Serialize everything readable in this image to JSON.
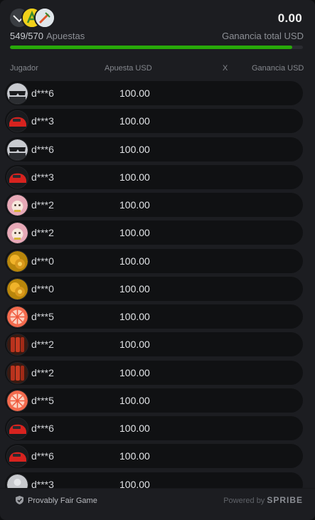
{
  "summary": {
    "total_win": "0.00",
    "bets_count": "549/570",
    "bets_label": "Apuestas",
    "total_win_label": "Ganancia total USD",
    "progress": 0.963
  },
  "columns": {
    "player": "Jugador",
    "bet": "Apuesta USD",
    "multiplier": "X",
    "win": "Ganancia USD"
  },
  "rows": [
    {
      "player": "d***6",
      "bet": "100.00",
      "avatar": "sunglasses-avatar"
    },
    {
      "player": "d***3",
      "bet": "100.00",
      "avatar": "red-car-avatar"
    },
    {
      "player": "d***6",
      "bet": "100.00",
      "avatar": "sunglasses-avatar"
    },
    {
      "player": "d***3",
      "bet": "100.00",
      "avatar": "red-car-avatar"
    },
    {
      "player": "d***2",
      "bet": "100.00",
      "avatar": "lucky-cat-avatar"
    },
    {
      "player": "d***2",
      "bet": "100.00",
      "avatar": "lucky-cat-avatar"
    },
    {
      "player": "d***0",
      "bet": "100.00",
      "avatar": "gold-coins-avatar"
    },
    {
      "player": "d***0",
      "bet": "100.00",
      "avatar": "gold-coins-avatar"
    },
    {
      "player": "d***5",
      "bet": "100.00",
      "avatar": "grapefruit-avatar"
    },
    {
      "player": "d***2",
      "bet": "100.00",
      "avatar": "firecracker-avatar"
    },
    {
      "player": "d***2",
      "bet": "100.00",
      "avatar": "firecracker-avatar"
    },
    {
      "player": "d***5",
      "bet": "100.00",
      "avatar": "grapefruit-avatar"
    },
    {
      "player": "d***6",
      "bet": "100.00",
      "avatar": "red-car-avatar"
    },
    {
      "player": "d***6",
      "bet": "100.00",
      "avatar": "red-car-avatar"
    },
    {
      "player": "d***3",
      "bet": "100.00",
      "avatar": "grey-avatar"
    }
  ],
  "footer": {
    "provably_fair": "Provably Fair Game",
    "powered_by": "Powered by",
    "brand": "SPRIBE"
  }
}
